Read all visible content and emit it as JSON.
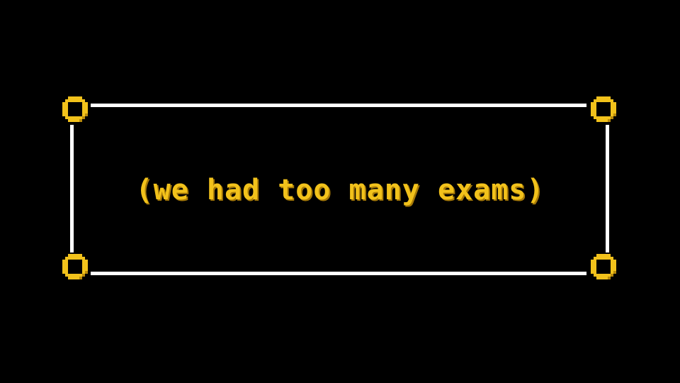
{
  "caption": {
    "text": "(we had too many exams)"
  },
  "colors": {
    "background": "#000000",
    "frame_line": "#ffffff",
    "corner_ring": "#f2c21b",
    "corner_ring_shade": "#b88a0c",
    "text": "#f2c21b"
  },
  "icons": {
    "corner": "pixel-ring-icon"
  }
}
